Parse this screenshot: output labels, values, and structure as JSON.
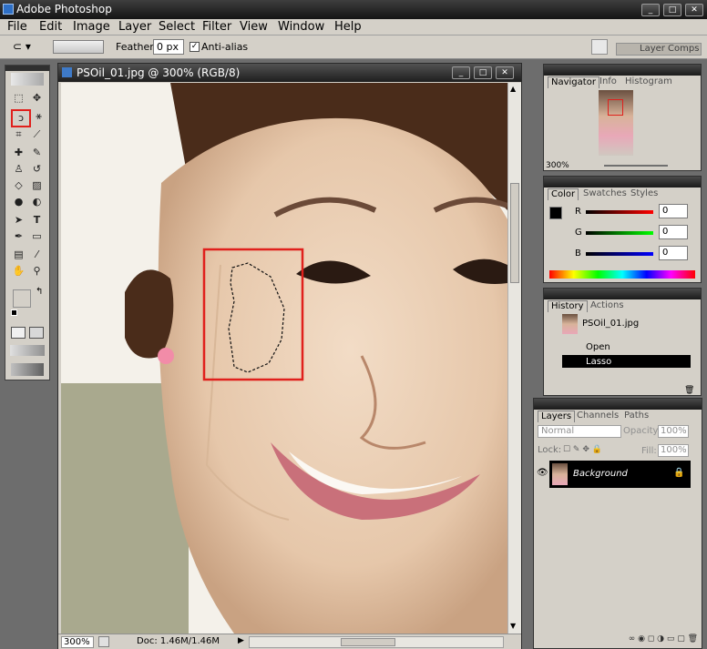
{
  "app": {
    "title": "Adobe Photoshop"
  },
  "menu": [
    "File",
    "Edit",
    "Image",
    "Layer",
    "Select",
    "Filter",
    "View",
    "Window",
    "Help"
  ],
  "options": {
    "feather_label": "Feather:",
    "feather_value": "0 px",
    "antialias_label": "Anti-alias",
    "antialias_checked": true,
    "layer_comps": "Layer Comps"
  },
  "document": {
    "title": "PSOil_01.jpg @ 300% (RGB/8)",
    "zoom": "300%",
    "doc_info": "Doc: 1.46M/1.46M"
  },
  "navigator": {
    "tabs": [
      "Navigator",
      "Info",
      "Histogram"
    ],
    "zoom": "300%"
  },
  "color": {
    "tabs": [
      "Color",
      "Swatches",
      "Styles"
    ],
    "r_label": "R",
    "g_label": "G",
    "b_label": "B",
    "r": "0",
    "g": "0",
    "b": "0",
    "fg": "#000000",
    "bg": "#ffffff"
  },
  "history": {
    "tabs": [
      "History",
      "Actions"
    ],
    "snapshot": "PSOil_01.jpg",
    "states": [
      "Open",
      "Lasso"
    ],
    "active_state": "Lasso"
  },
  "layers": {
    "tabs": [
      "Layers",
      "Channels",
      "Paths"
    ],
    "blend_mode": "Normal",
    "opacity_label": "Opacity:",
    "opacity": "100%",
    "lock_label": "Lock:",
    "fill_label": "Fill:",
    "fill": "100%",
    "items": [
      {
        "name": "Background",
        "visible": true,
        "locked": true,
        "selected": true
      }
    ]
  },
  "colors": {
    "highlight_box": "#e0201c",
    "selected_row": "#000000"
  }
}
